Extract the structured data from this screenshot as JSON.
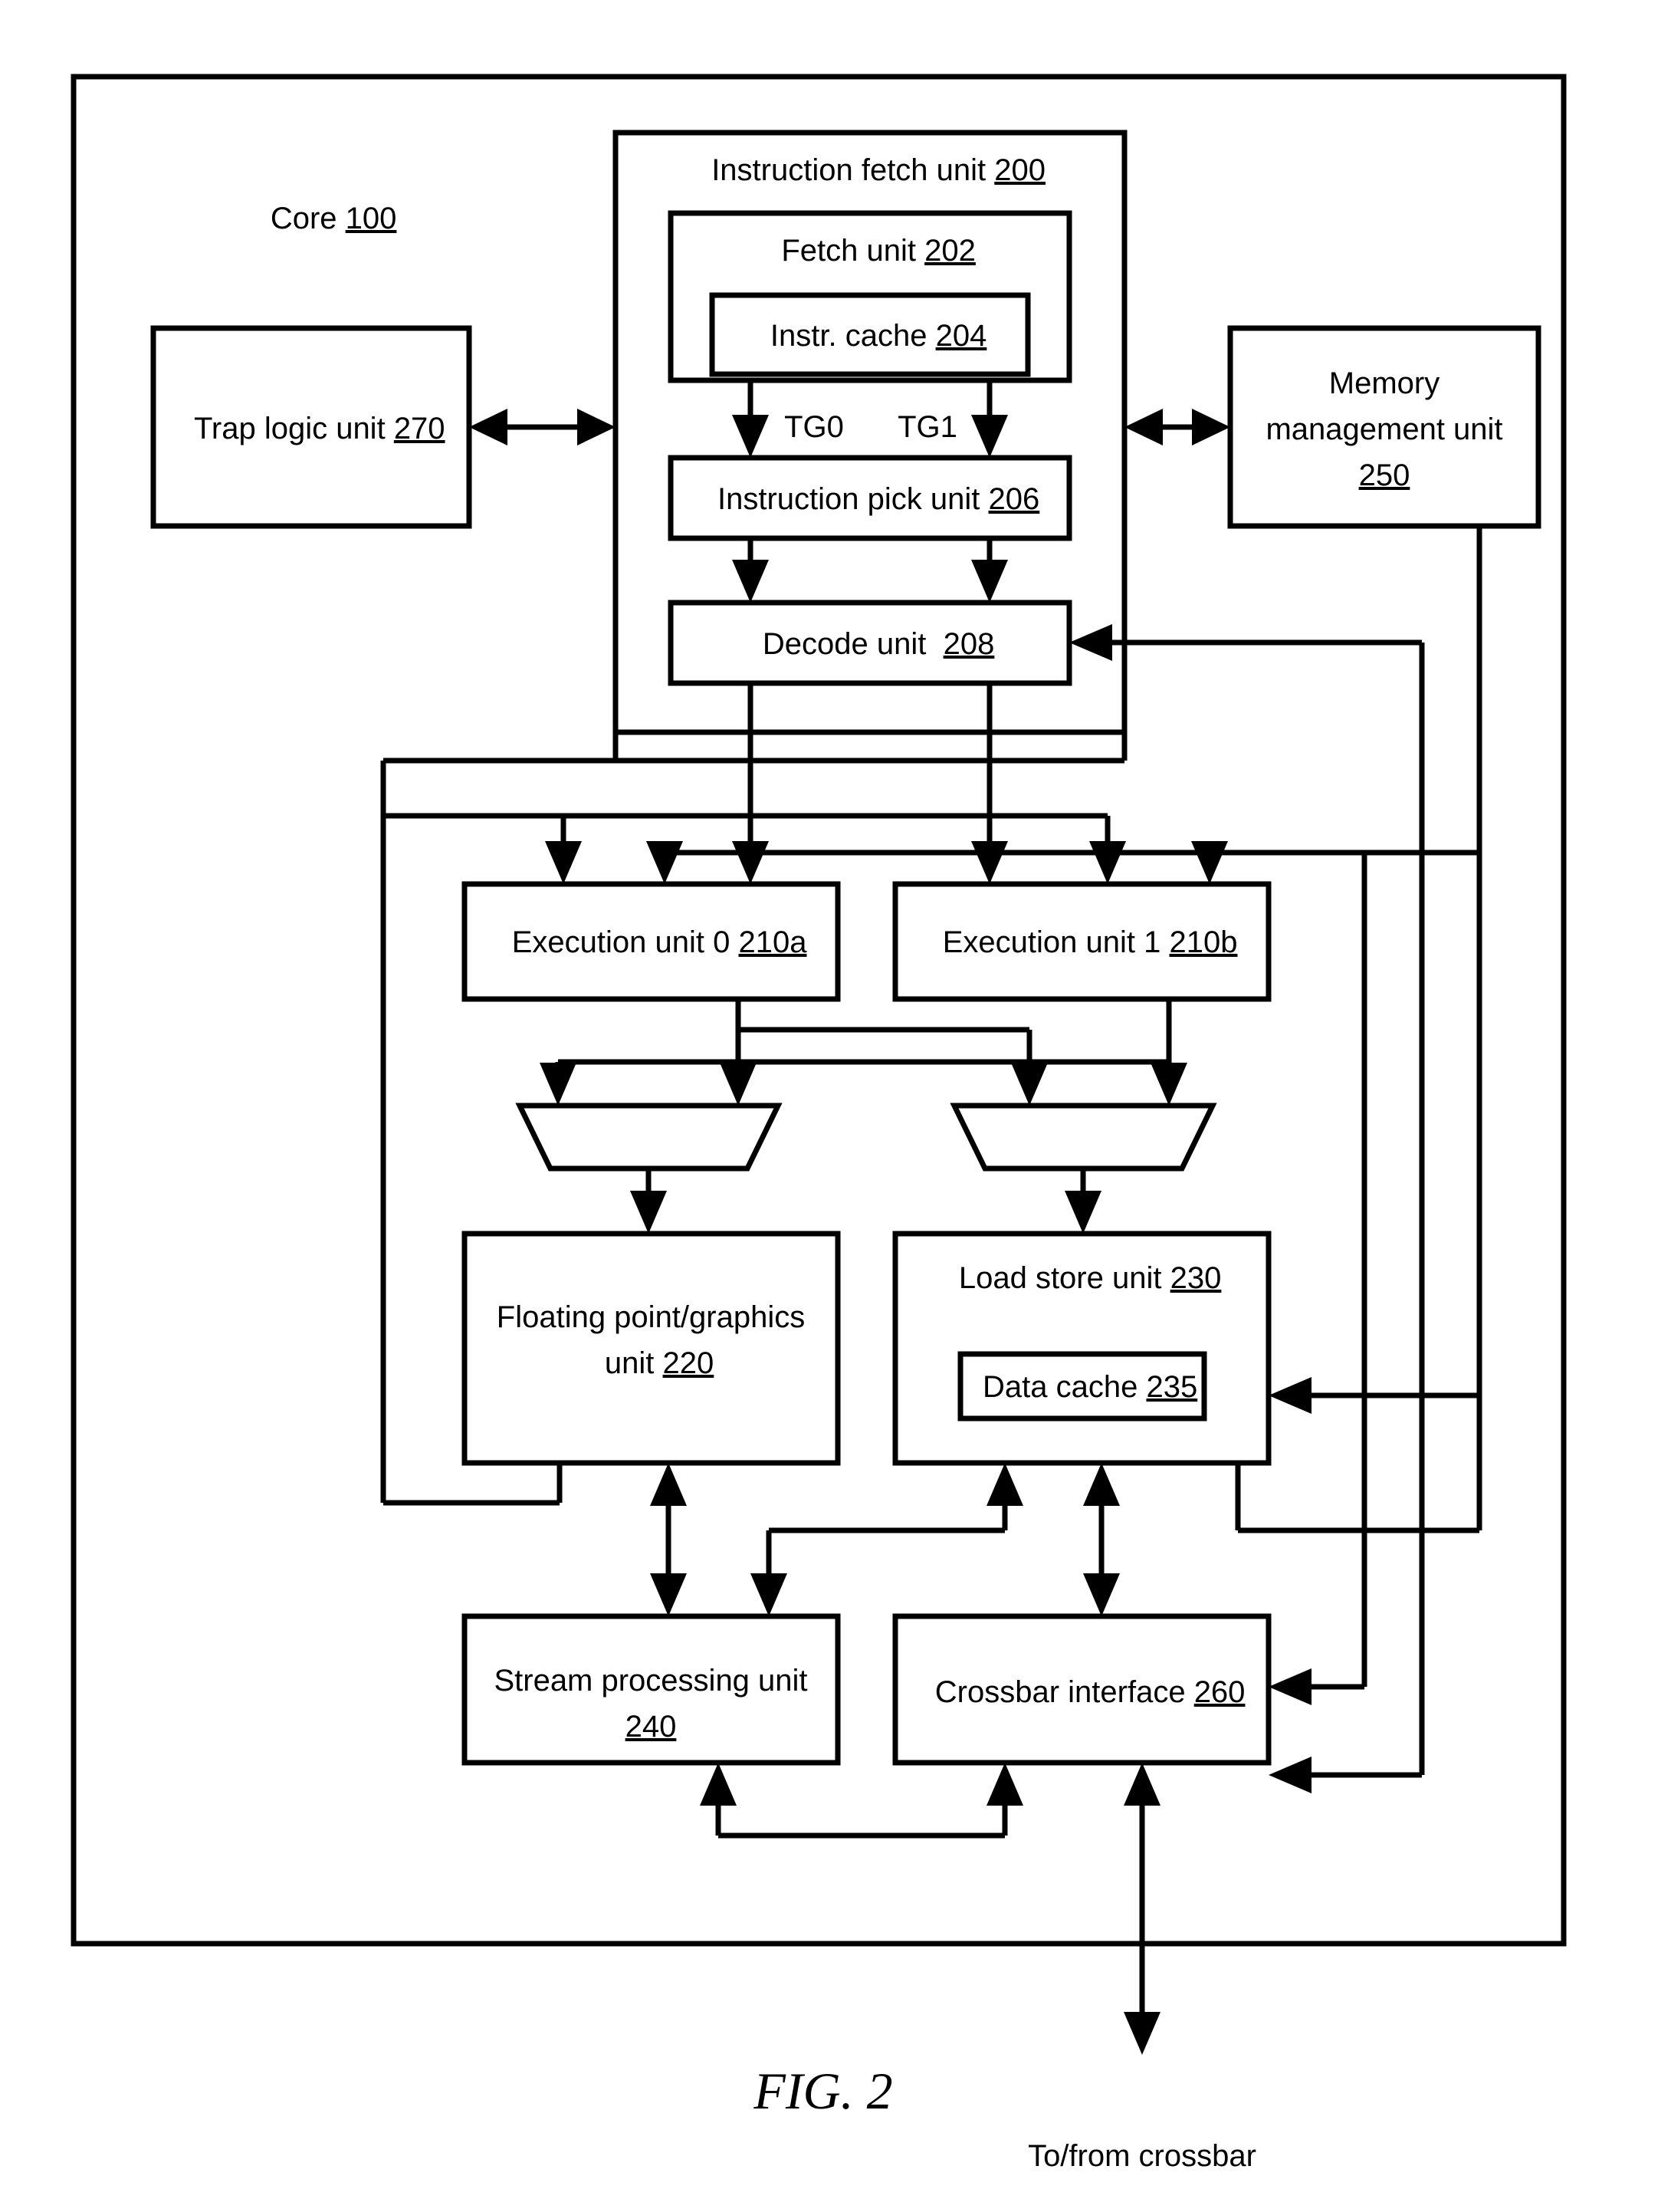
{
  "figure": {
    "caption": "FIG. 2",
    "external_label": "To/from crossbar"
  },
  "core": {
    "label": "Core",
    "ref": "100"
  },
  "blocks": {
    "instruction_fetch_unit": {
      "label": "Instruction fetch unit",
      "ref": "200"
    },
    "fetch_unit": {
      "label": "Fetch unit",
      "ref": "202"
    },
    "instr_cache": {
      "label": "Instr. cache",
      "ref": "204"
    },
    "instruction_pick_unit": {
      "label": "Instruction pick unit",
      "ref": "206"
    },
    "decode_unit": {
      "label": "Decode unit ",
      "ref": "208"
    },
    "trap_logic_unit": {
      "label": "Trap logic unit",
      "ref": "270"
    },
    "memory_management_unit": {
      "label_line1": "Memory",
      "label_line2": "management unit",
      "ref": "250"
    },
    "execution_unit_0": {
      "label": "Execution unit 0",
      "ref": "210a"
    },
    "execution_unit_1": {
      "label": "Execution unit 1",
      "ref": "210b"
    },
    "fpu": {
      "label_line1": "Floating point/graphics",
      "label_line2": "unit",
      "ref": "220"
    },
    "load_store_unit": {
      "label": "Load store unit",
      "ref": "230"
    },
    "data_cache": {
      "label": "Data cache",
      "ref": "235"
    },
    "stream_processing_unit": {
      "label": "Stream processing unit",
      "ref": "240"
    },
    "crossbar_interface": {
      "label": "Crossbar interface",
      "ref": "260"
    }
  },
  "signals": {
    "tg0": "TG0",
    "tg1": "TG1"
  },
  "colors": {
    "line": "#000000",
    "fill": "#ffffff"
  }
}
